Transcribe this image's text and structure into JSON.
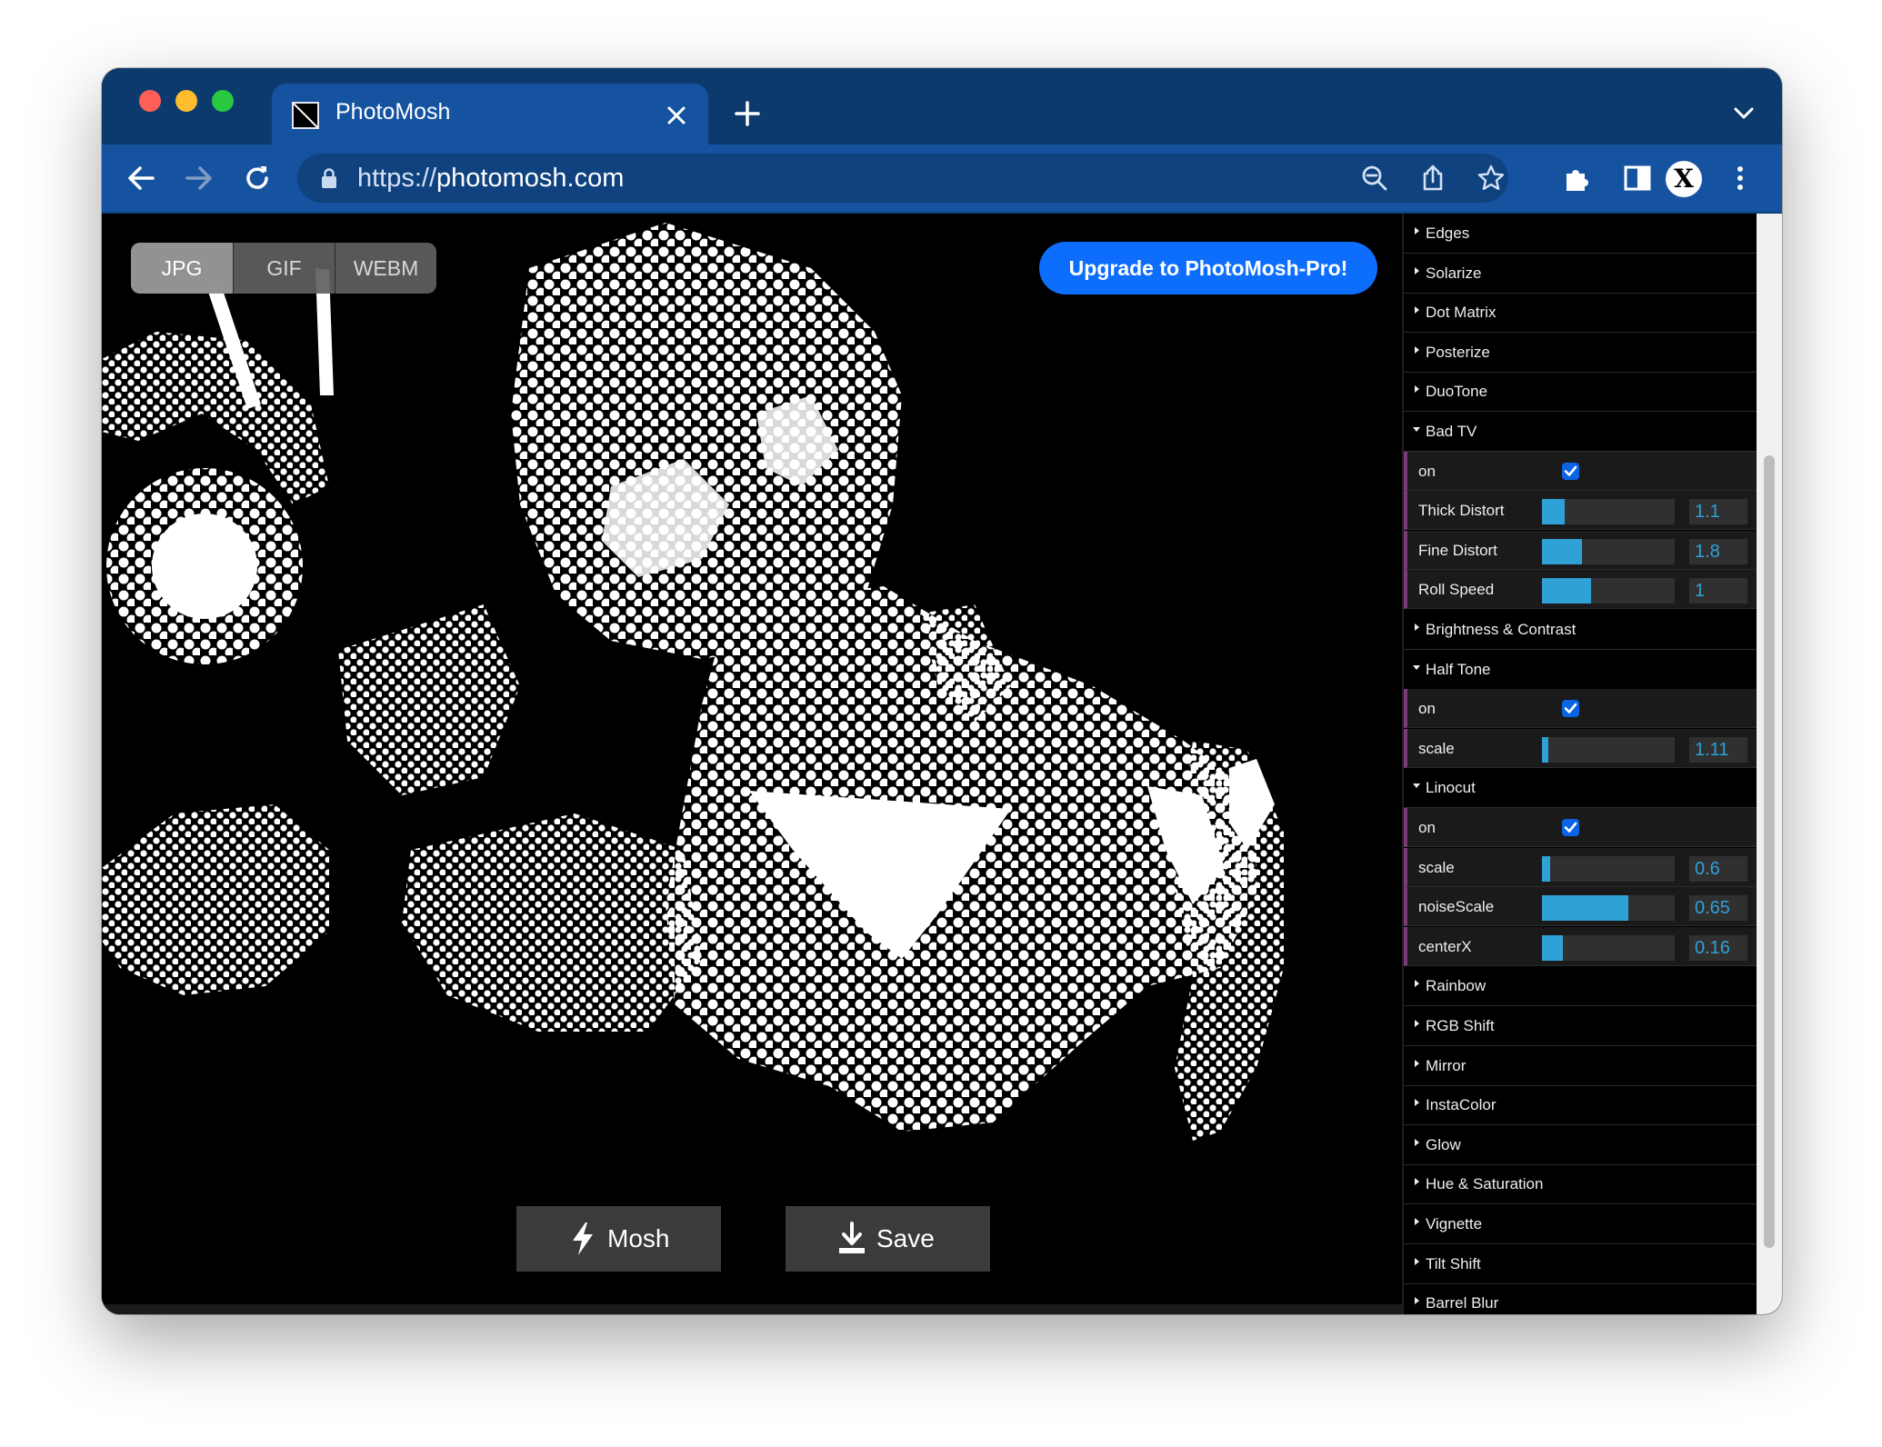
{
  "browser": {
    "tab_title": "PhotoMosh",
    "url_scheme": "https://",
    "url_domain": "photomosh.com"
  },
  "canvas": {
    "formats": [
      "JPG",
      "GIF",
      "WEBM"
    ],
    "active_format": "JPG",
    "upgrade_label": "Upgrade to PhotoMosh-Pro!",
    "mosh_label": "Mosh",
    "save_label": "Save"
  },
  "panel": {
    "accent_color": "#2fa1d6",
    "checkbox_color": "#0b63e6",
    "rows": [
      {
        "type": "folder",
        "title": "Edges",
        "open": false
      },
      {
        "type": "folder",
        "title": "Solarize",
        "open": false
      },
      {
        "type": "folder",
        "title": "Dot Matrix",
        "open": false
      },
      {
        "type": "folder",
        "title": "Posterize",
        "open": false
      },
      {
        "type": "folder",
        "title": "DuoTone",
        "open": false
      },
      {
        "type": "folder",
        "title": "Bad TV",
        "open": true
      },
      {
        "type": "checkbox",
        "label": "on",
        "checked": true
      },
      {
        "type": "slider",
        "label": "Thick Distort",
        "value": "1.1",
        "fill": 0.17
      },
      {
        "type": "slider",
        "label": "Fine Distort",
        "value": "1.8",
        "fill": 0.3
      },
      {
        "type": "slider",
        "label": "Roll Speed",
        "value": "1",
        "fill": 0.37
      },
      {
        "type": "folder",
        "title": "Brightness & Contrast",
        "open": false
      },
      {
        "type": "folder",
        "title": "Half Tone",
        "open": true
      },
      {
        "type": "checkbox",
        "label": "on",
        "checked": true
      },
      {
        "type": "slider",
        "label": "scale",
        "value": "1.11",
        "fill": 0.05
      },
      {
        "type": "folder",
        "title": "Linocut",
        "open": true
      },
      {
        "type": "checkbox",
        "label": "on",
        "checked": true
      },
      {
        "type": "slider",
        "label": "scale",
        "value": "0.6",
        "fill": 0.06
      },
      {
        "type": "slider",
        "label": "noiseScale",
        "value": "0.65",
        "fill": 0.65
      },
      {
        "type": "slider",
        "label": "centerX",
        "value": "0.16",
        "fill": 0.16
      },
      {
        "type": "folder",
        "title": "Rainbow",
        "open": false
      },
      {
        "type": "folder",
        "title": "RGB Shift",
        "open": false
      },
      {
        "type": "folder",
        "title": "Mirror",
        "open": false
      },
      {
        "type": "folder",
        "title": "InstaColor",
        "open": false
      },
      {
        "type": "folder",
        "title": "Glow",
        "open": false
      },
      {
        "type": "folder",
        "title": "Hue & Saturation",
        "open": false
      },
      {
        "type": "folder",
        "title": "Vignette",
        "open": false
      },
      {
        "type": "folder",
        "title": "Tilt Shift",
        "open": false
      },
      {
        "type": "folder",
        "title": "Barrel Blur",
        "open": false
      }
    ]
  }
}
